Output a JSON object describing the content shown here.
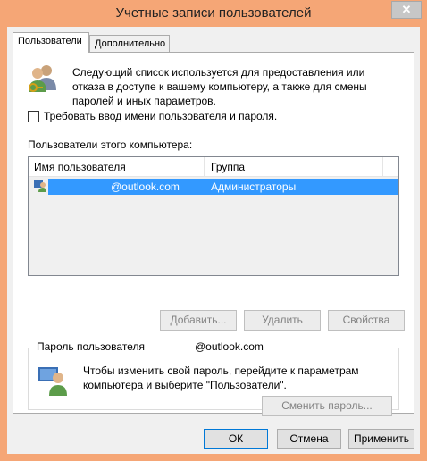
{
  "window": {
    "title": "Учетные записи пользователей",
    "close_glyph": "✕"
  },
  "tabs": [
    {
      "label": "Пользователи",
      "active": true
    },
    {
      "label": "Дополнительно",
      "active": false
    }
  ],
  "intro_text": "Следующий список используется для предоставления или отказа в доступе к вашему компьютеру, а также для смены паролей и иных параметров.",
  "require_login": {
    "label": "Требовать ввод имени пользователя и пароля.",
    "checked": false
  },
  "users_section_label": "Пользователи этого компьютера:",
  "table": {
    "columns": [
      "Имя пользователя",
      "Группа"
    ],
    "rows": [
      {
        "username": "@outlook.com",
        "group": "Администраторы",
        "selected": true
      }
    ]
  },
  "list_buttons": {
    "add": "Добавить...",
    "remove": "Удалить",
    "properties": "Свойства"
  },
  "password_group": {
    "label": "Пароль пользователя",
    "email": "@outlook.com",
    "text": "Чтобы изменить свой пароль, перейдите к параметрам компьютера и выберите \"Пользователи\".",
    "change_button": "Сменить пароль..."
  },
  "dialog_buttons": {
    "ok": "ОК",
    "cancel": "Отмена",
    "apply": "Применить"
  },
  "colors": {
    "frame": "#f5a676",
    "selection": "#3399ff",
    "default_border": "#0078d7"
  },
  "icons": [
    "users-group-icon",
    "user-row-icon",
    "user-key-icon",
    "close-icon"
  ]
}
